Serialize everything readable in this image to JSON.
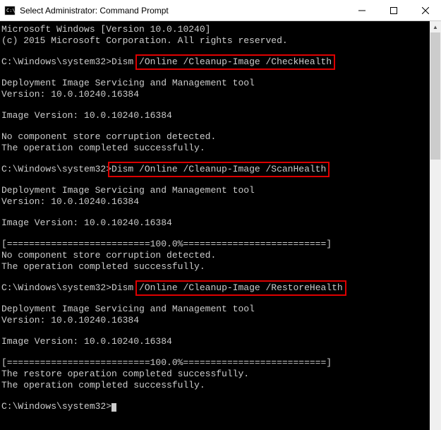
{
  "titlebar": {
    "title": "Select Administrator: Command Prompt"
  },
  "terminal": {
    "ver_line": "Microsoft Windows [Version 10.0.10240]",
    "copyright": "(c) 2015 Microsoft Corporation. All rights reserved.",
    "prompt": "C:\\Windows\\system32>",
    "prompt_dism": "C:\\Windows\\system32>Dism ",
    "cmd1_hl": "/Online /Cleanup-Image /CheckHealth",
    "cmd2_hl": "Dism /Online /Cleanup-Image /ScanHealth",
    "cmd3_prefix": "C:\\Windows\\system32>Dism ",
    "cmd3_hl": "/Online /Cleanup-Image /RestoreHealth",
    "dism_tool": "Deployment Image Servicing and Management tool",
    "version": "Version: 10.0.10240.16384",
    "image_ver": "Image Version: 10.0.10240.16384",
    "no_corrupt": "No component store corruption detected.",
    "op_success": "The operation completed successfully.",
    "progress": "[==========================100.0%==========================]",
    "restore_success": "The restore operation completed successfully."
  }
}
